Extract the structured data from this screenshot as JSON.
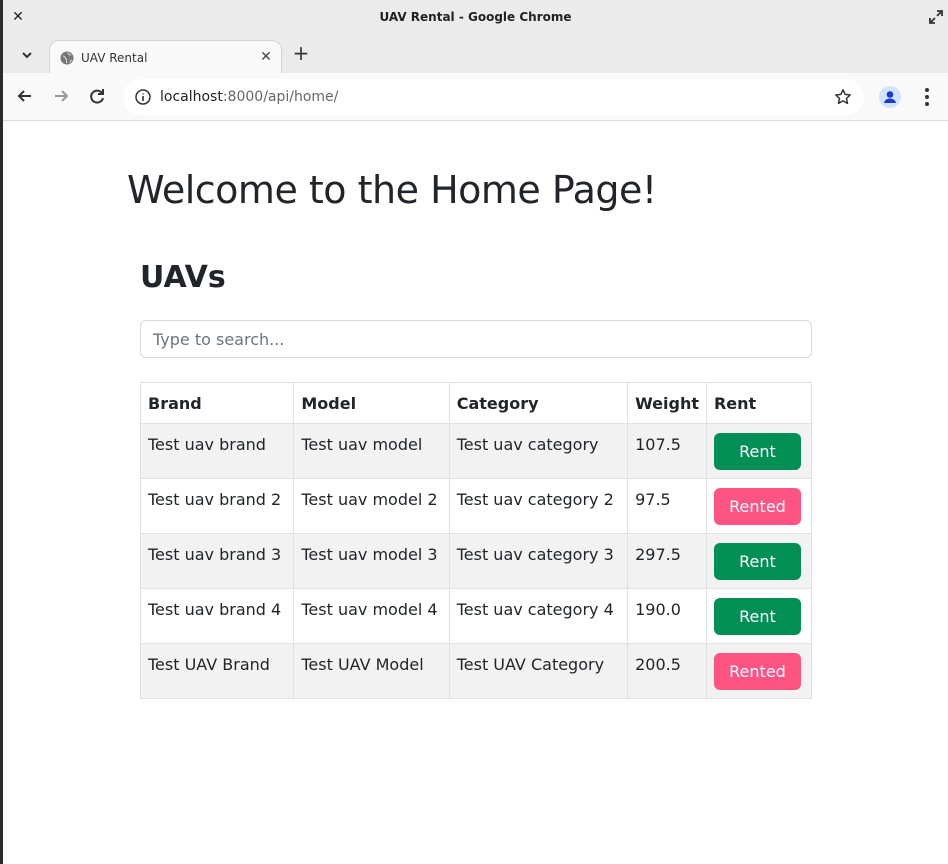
{
  "window": {
    "title": "UAV Rental - Google Chrome"
  },
  "tabs": [
    {
      "title": "UAV Rental"
    }
  ],
  "address_bar": {
    "host": "localhost",
    "rest": ":8000/api/home/"
  },
  "page": {
    "heading": "Welcome to the Home Page!",
    "section_heading": "UAVs",
    "search": {
      "placeholder": "Type to search...",
      "value": ""
    },
    "table": {
      "columns": [
        "Brand",
        "Model",
        "Category",
        "Weight",
        "Rent"
      ],
      "rows": [
        {
          "brand": "Test uav brand",
          "model": "Test uav model",
          "category": "Test uav category",
          "weight": "107.5",
          "action": "Rent",
          "status": "available"
        },
        {
          "brand": "Test uav brand 2",
          "model": "Test uav model 2",
          "category": "Test uav category 2",
          "weight": "97.5",
          "action": "Rented",
          "status": "rented"
        },
        {
          "brand": "Test uav brand 3",
          "model": "Test uav model 3",
          "category": "Test uav category 3",
          "weight": "297.5",
          "action": "Rent",
          "status": "available"
        },
        {
          "brand": "Test uav brand 4",
          "model": "Test uav model 4",
          "category": "Test uav category 4",
          "weight": "190.0",
          "action": "Rent",
          "status": "available"
        },
        {
          "brand": "Test UAV Brand",
          "model": "Test UAV Model",
          "category": "Test UAV Category",
          "weight": "200.5",
          "action": "Rented",
          "status": "rented"
        }
      ]
    }
  },
  "colors": {
    "rent": "#028f55",
    "rented": "#fd5483"
  },
  "icons": [
    "close-icon",
    "maximize-icon",
    "tab-search-icon",
    "globe-icon",
    "tab-close-icon",
    "new-tab-icon",
    "back-icon",
    "forward-icon",
    "reload-icon",
    "site-info-icon",
    "bookmark-star-icon",
    "profile-icon",
    "menu-icon"
  ]
}
